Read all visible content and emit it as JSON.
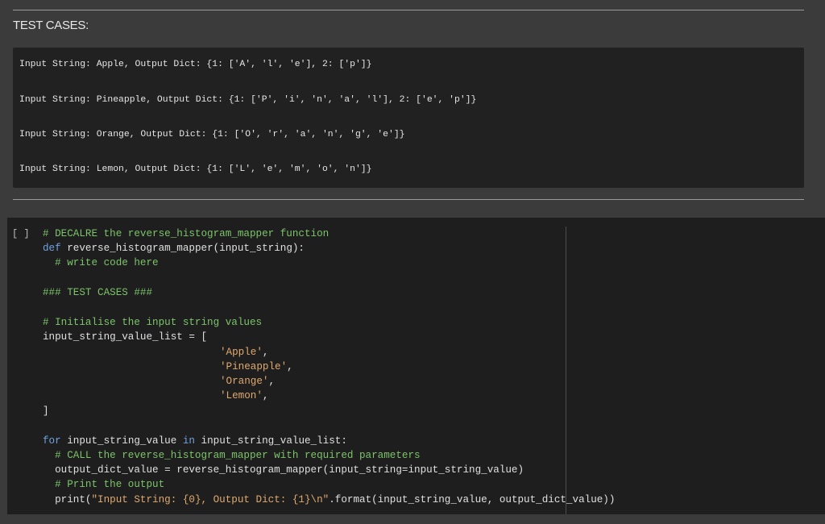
{
  "text_section": {
    "heading": "TEST CASES:",
    "test_cases": [
      "Input String: Apple, Output Dict: {1: ['A', 'l', 'e'], 2: ['p']}",
      "Input String: Pineapple, Output Dict: {1: ['P', 'i', 'n', 'a', 'l'], 2: ['e', 'p']}",
      "Input String: Orange, Output Dict: {1: ['O', 'r', 'a', 'n', 'g', 'e']}",
      "Input String: Lemon, Output Dict: {1: ['L', 'e', 'm', 'o', 'n']}"
    ]
  },
  "code_cell": {
    "run_label": "[ ]",
    "lines": {
      "l1": "# DECALRE the reverse_histogram_mapper function",
      "l2_kw": "def",
      "l2_rest": " reverse_histogram_mapper(input_string):",
      "l3": "  # write code here",
      "l5": "### TEST CASES ###",
      "l7": "# Initialise the input string values",
      "l8": "input_string_value_list = [",
      "l9": "'Apple'",
      "l10": "'Pineapple'",
      "l11": "'Orange'",
      "l12": "'Lemon'",
      "comma": ",",
      "l13": "]",
      "l15_kw1": "for",
      "l15_mid": " input_string_value ",
      "l15_kw2": "in",
      "l15_rest": " input_string_value_list:",
      "l16": "  # CALL the reverse_histogram_mapper with required parameters",
      "l17": "  output_dict_value = reverse_histogram_mapper(input_string=input_string_value)",
      "l18": "  # Print the output",
      "l19_a": "  print(",
      "l19_str": "\"Input String: {0}, Output Dict: {1}\\n\"",
      "l19_b": ".format(input_string_value, output_dict_value))"
    }
  }
}
